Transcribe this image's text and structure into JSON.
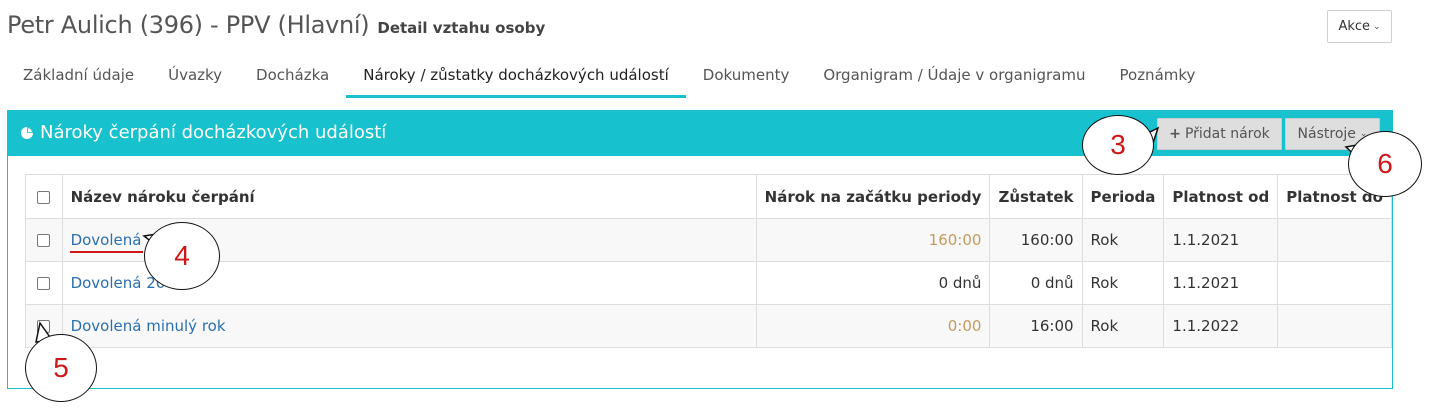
{
  "header": {
    "person_title": "Petr Aulich (396) - PPV (Hlavní)",
    "subtitle": "Detail vztahu osoby",
    "actions_button": "Akce"
  },
  "tabs": [
    {
      "label": "Základní údaje",
      "active": false
    },
    {
      "label": "Úvazky",
      "active": false
    },
    {
      "label": "Docházka",
      "active": false
    },
    {
      "label": "Nároky / zůstatky docházkových událostí",
      "active": true
    },
    {
      "label": "Dokumenty",
      "active": false
    },
    {
      "label": "Organigram / Údaje v organigramu",
      "active": false
    },
    {
      "label": "Poznámky",
      "active": false
    }
  ],
  "panel": {
    "title": "Nároky čerpání docházkových událostí",
    "add_button": "Přidat nárok",
    "tools_button": "Nástroje",
    "accent_color": "#17c1cd"
  },
  "table": {
    "columns": [
      "Název nároku čerpání",
      "Nárok na začátku periody",
      "Zůstatek",
      "Perioda",
      "Platnost od",
      "Platnost do"
    ],
    "rows": [
      {
        "name": "Dovolená",
        "start": "160:00",
        "balance": "160:00",
        "period": "Rok",
        "valid_from": "1.1.2021",
        "valid_to": ""
      },
      {
        "name": "Dovolená 20",
        "start": "0 dnů",
        "balance": "0 dnů",
        "period": "Rok",
        "valid_from": "1.1.2021",
        "valid_to": ""
      },
      {
        "name": "Dovolená minulý rok",
        "start": "0:00",
        "balance": "16:00",
        "period": "Rok",
        "valid_from": "1.1.2022",
        "valid_to": ""
      }
    ]
  },
  "callouts": {
    "c3": "3",
    "c4": "4",
    "c5": "5",
    "c6": "6"
  }
}
